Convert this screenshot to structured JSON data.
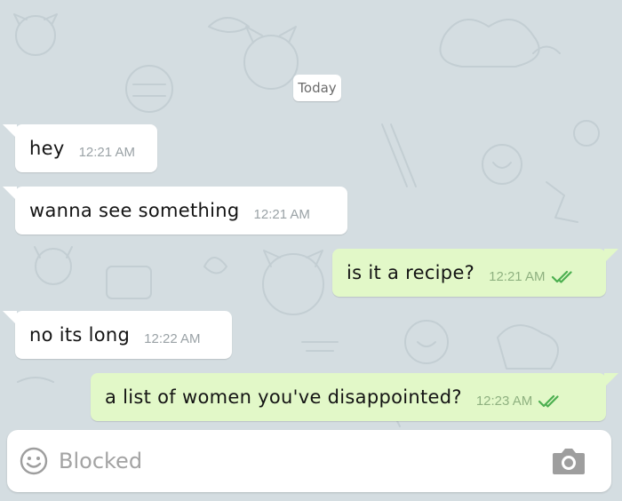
{
  "chat": {
    "date_chip": "Today",
    "messages": [
      {
        "direction": "in",
        "text": "hey",
        "time": "12:21 AM"
      },
      {
        "direction": "in",
        "text": "wanna see something",
        "time": "12:21 AM"
      },
      {
        "direction": "out",
        "text": "is it a recipe?",
        "time": "12:21 AM",
        "status": "read"
      },
      {
        "direction": "in",
        "text": "no its long",
        "time": "12:22 AM"
      },
      {
        "direction": "out",
        "text": "a list of women you've disappointed?",
        "time": "12:23 AM",
        "status": "read"
      }
    ]
  },
  "composer": {
    "placeholder": "Blocked",
    "emoji_icon": "smiley-icon",
    "camera_icon": "camera-icon"
  },
  "colors": {
    "wallpaper": "#d4dde1",
    "incoming_bubble": "#ffffff",
    "outgoing_bubble": "#e2f8c8",
    "read_ticks": "#4caf50"
  }
}
